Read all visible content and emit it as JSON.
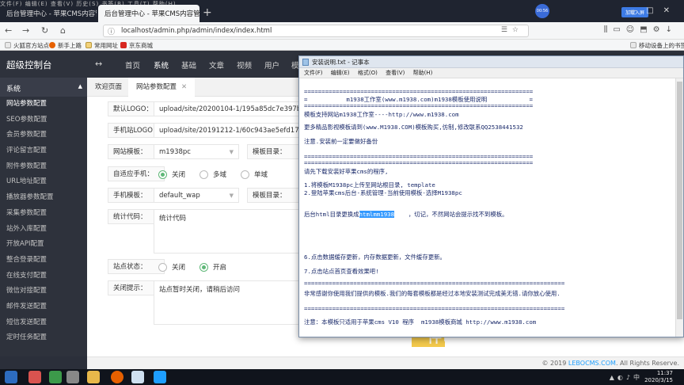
{
  "browser": {
    "menu_ghost": "文件(F)  编辑(E)  查看(V)  历史(S)  书签(B)  工具(T)  帮助(H)",
    "tabs": [
      {
        "label": "后台管理中心 - 苹果CMS内容管理",
        "active": false
      },
      {
        "label": "后台管理中心 - 苹果CMS内容管理",
        "active": true
      }
    ],
    "avatar_text": "00:56",
    "webapp_label": "加载入屏",
    "url": "localhost/admin.php/admin/index/index.html",
    "bookmarks": [
      "火狐官方站点",
      "新手上路",
      "常用网址",
      "京东商城"
    ],
    "mobile_bookmark": "移动设备上的书签"
  },
  "app": {
    "brand": "超级控制台",
    "topnav": [
      "首页",
      "系统",
      "基础",
      "文章",
      "视频",
      "用户",
      "模"
    ],
    "active_topnav": "系统",
    "sidebar_head": "系统",
    "sidebar": [
      "网站参数配置",
      "SEO参数配置",
      "会员参数配置",
      "评论留言配置",
      "附件参数配置",
      "URL地址配置",
      "播放器参数配置",
      "采集参数配置",
      "站外入库配置",
      "开放API配置",
      "整合登录配置",
      "在线支付配置",
      "微信对接配置",
      "邮件发送配置",
      "短信发送配置",
      "定时任务配置"
    ],
    "content_tabs": [
      "欢迎页面",
      "网站参数配置"
    ],
    "form": {
      "logo_label": "默认LOGO：",
      "logo_value": "upload/site/20200104-1/195a85dc7e397b85db",
      "mobile_logo_label": "手机站LOGO：",
      "mobile_logo_value": "upload/site/20191212-1/60c943ae5efd17f8b2",
      "template_label": "网站模板：",
      "template_value": "m1938pc",
      "template_dir_label": "模板目录：",
      "adapt_label": "自适应手机：",
      "adapt_options": [
        "关闭",
        "多域",
        "单域"
      ],
      "mobile_template_label": "手机模板：",
      "mobile_template_value": "default_wap",
      "mobile_dir_label": "模板目录：",
      "stats_label": "统计代码：",
      "stats_value": "统计代码",
      "status_label": "站点状态：",
      "status_options": [
        "关闭",
        "开启"
      ],
      "close_tip_label": "关闭提示：",
      "close_tip_value": "站点暂时关闭，请稍后访问"
    },
    "footer": {
      "prefix": "© 2019 ",
      "brand": "LEBOCMS.COM",
      "suffix": ". All Rights Reserve."
    }
  },
  "caption": "了美板是个个一件吧",
  "notepad": {
    "title": "安装说明.txt - 记事本",
    "menu": [
      "文件(F)",
      "编辑(E)",
      "格式(O)",
      "查看(V)",
      "帮助(H)"
    ],
    "lines": [
      "=================================================================",
      "=           m1938工作室(www.m1938.com)m1938模板使用说明            =",
      "=================================================================",
      "模板支持网站m1938工作室----http://www.m1938.com",
      "",
      "更多精品影视模板请到(www.M1938.COM)模板购买,仿制,修改联系QQ2538441532",
      "",
      "注意.安装前一定要做好备份",
      "",
      "=================================================================",
      "=================================================================",
      "请先下载安装好苹果cms的程序,",
      "",
      "1.将模板M1938pc上传至网站根目录, template",
      "2.登陆苹果cms后台-系统管理-当前使用模板-选择M1938pc",
      "",
      "",
      "后台html目录更换成",
      "",
      "",
      "",
      "",
      "",
      "6.点击数据缓存更新，内存数据更新，文件缓存更新。",
      "",
      "7.点击站点首页查看效果吧!",
      "",
      "==========================================================================",
      "非常感谢你使用我们提供的模板.我们的每套模板都是经过本地安装测试完成美无错.请你放心使用.",
      "",
      "==========================================================================",
      "",
      "注意：本模板只适用于苹果cms V10 程序  m1938模板商城 http://www.m1938.com"
    ],
    "selected_text": "htmlmm1938",
    "after_selected": "    ，切记，不然网站会提示找不到模板。"
  },
  "taskbar": {
    "time": "11:37",
    "date": "2020/3/15"
  }
}
